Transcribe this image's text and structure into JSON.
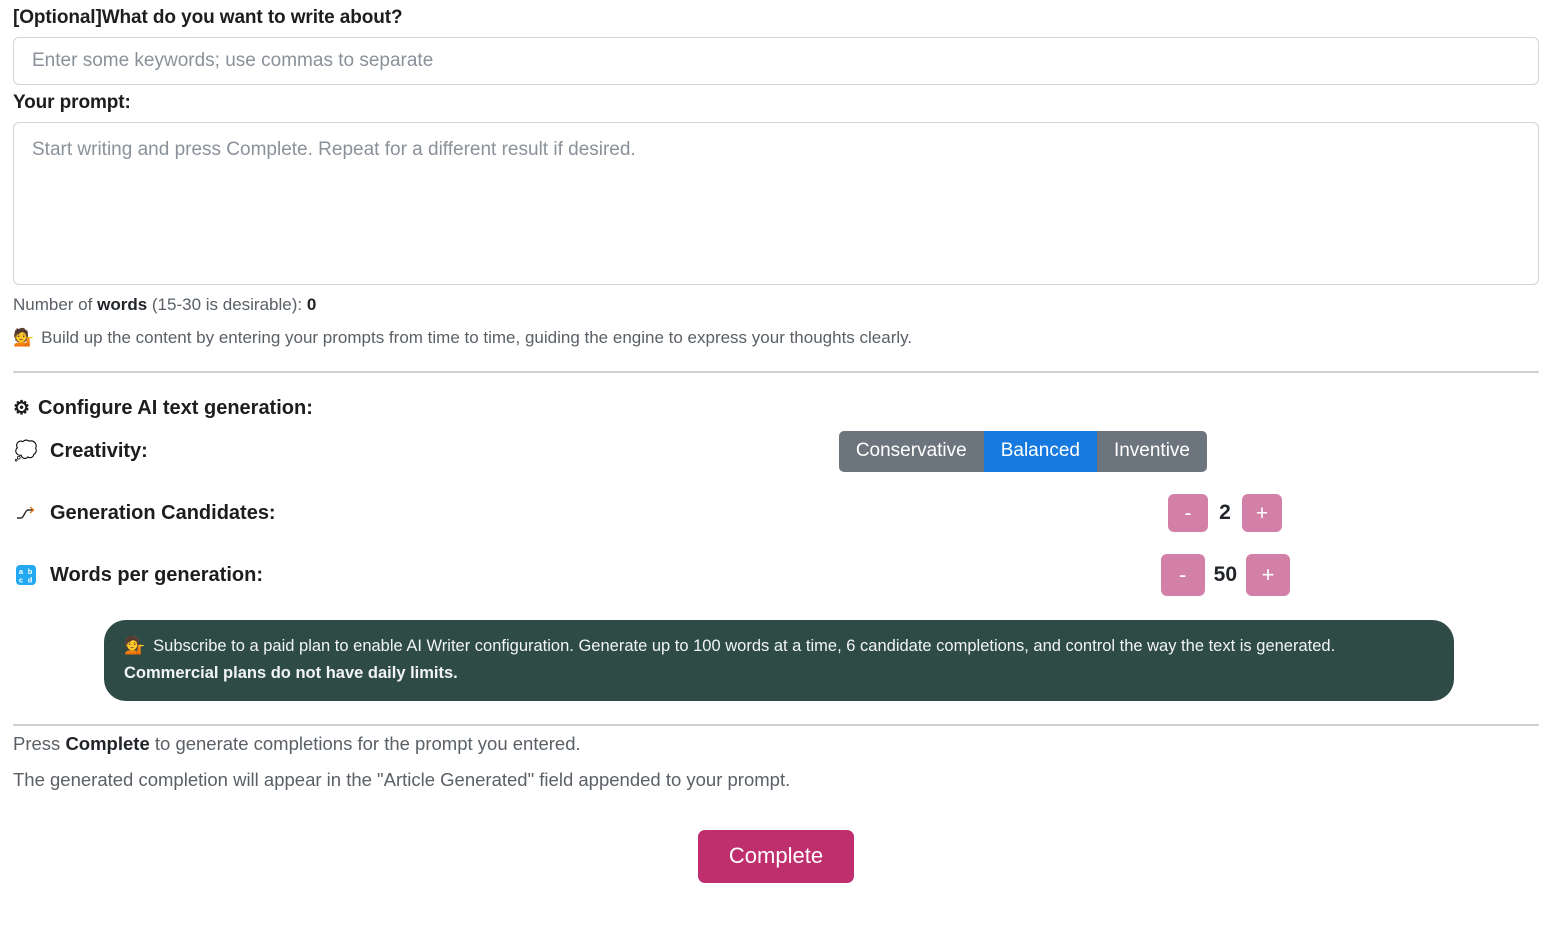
{
  "keywords": {
    "label": "[Optional]What do you want to write about?",
    "placeholder": "Enter some keywords; use commas to separate",
    "value": ""
  },
  "prompt": {
    "label": "Your prompt:",
    "placeholder": "Start writing and press Complete. Repeat for a different result if desired.",
    "value": ""
  },
  "word_count": {
    "prefix": "Number of ",
    "bold": "words",
    "suffix": " (15-30 is desirable): ",
    "count": "0"
  },
  "build_hint": {
    "icon": "person-tipping-hand-icon",
    "emoji": "💁",
    "text": "Build up the content by entering your prompts from time to time, guiding the engine to express your thoughts clearly."
  },
  "config": {
    "title": "Configure AI text generation:",
    "gear_icon": "gear-icon",
    "gear_glyph": "⚙",
    "creativity": {
      "label": "Creativity:",
      "icon": "thought-bubble-icon",
      "icon_glyph": "💭",
      "options": [
        "Conservative",
        "Balanced",
        "Inventive"
      ],
      "selected": "Balanced",
      "active_color": "#1579e0",
      "inactive_color": "#6c757d"
    },
    "candidates": {
      "label": "Generation Candidates:",
      "icon": "curve-line-icon",
      "icon_glyph": "⤴",
      "value": "2",
      "minus_label": "-",
      "plus_label": "+",
      "button_color": "#d380a8"
    },
    "words_per_generation": {
      "label": "Words per generation:",
      "icon": "input-latin-lowercase-icon",
      "icon_glyph": "🔡",
      "value": "50",
      "minus_label": "-",
      "plus_label": "+",
      "button_color": "#d380a8"
    }
  },
  "notice": {
    "icon": "person-tipping-hand-icon",
    "emoji": "💁",
    "line1": "Subscribe to a paid plan to enable AI Writer configuration. Generate up to 100 words at a time, 6 candidate completions, and control the way the text is generated.",
    "line2": "Commercial plans do not have daily limits.",
    "background": "#2e4b46"
  },
  "footer": {
    "line1_prefix": "Press ",
    "line1_bold": "Complete",
    "line1_suffix": " to generate completions for the prompt you entered.",
    "line2": "The generated completion will appear in the \"Article Generated\" field appended to your prompt.",
    "button_label": "Complete",
    "button_color": "#bf2f6d"
  }
}
